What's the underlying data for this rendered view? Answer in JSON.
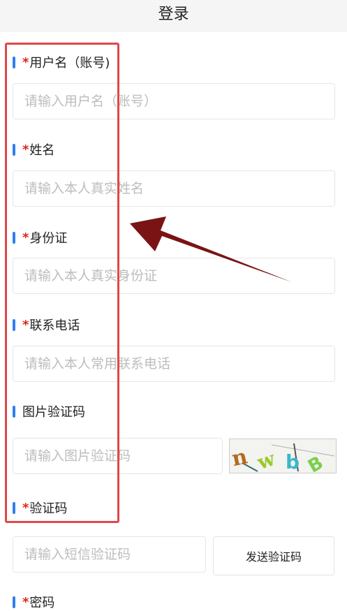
{
  "header": {
    "title": "登录"
  },
  "form": {
    "required_mark": "*",
    "username": {
      "label": "用户名（账号)",
      "placeholder": "请输入用户名（账号）"
    },
    "name": {
      "label": "姓名",
      "placeholder": "请输入本人真实姓名"
    },
    "id_card": {
      "label": "身份证",
      "placeholder": "请输入本人真实身份证"
    },
    "phone": {
      "label": "联系电话",
      "placeholder": "请输入本人常用联系电话"
    },
    "image_code": {
      "label": "图片验证码",
      "placeholder": "请输入图片验证码"
    },
    "sms_code": {
      "label": "验证码",
      "placeholder": "请输入短信验证码",
      "send_button": "发送验证码"
    },
    "password": {
      "label": "密码"
    }
  },
  "captcha_text": "nwbB",
  "colors": {
    "accent_bar": "#2f7ff0",
    "required": "#e0251b",
    "highlight_box": "#e04848",
    "arrow": "#7a1414"
  }
}
